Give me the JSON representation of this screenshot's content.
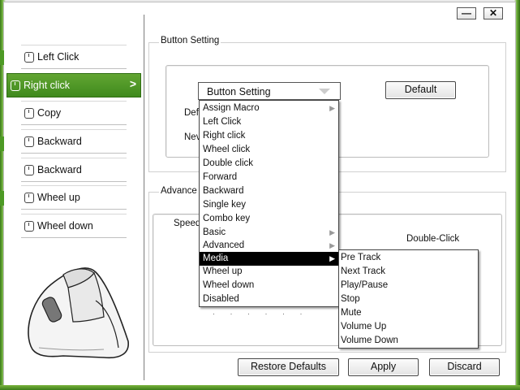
{
  "window": {
    "minimize_label": "—",
    "close_label": "✕"
  },
  "sidebar": {
    "items": [
      {
        "label": "Left Click"
      },
      {
        "label": "Right click"
      },
      {
        "label": "Copy"
      },
      {
        "label": "Backward"
      },
      {
        "label": "Backward"
      },
      {
        "label": "Wheel up"
      },
      {
        "label": "Wheel down"
      }
    ],
    "active_index": 1,
    "active_chevron": ">"
  },
  "button_setting": {
    "group_title": "Button Setting",
    "select_value": "Button Setting",
    "default_button": "Default",
    "field_label_1": "Def",
    "field_label_2": "Nev"
  },
  "advanced": {
    "group_title": "Advance",
    "speed_label": "Speed",
    "double_click_label": "Double-Click"
  },
  "dropdown": {
    "items": [
      {
        "label": "Assign Macro",
        "has_submenu": true
      },
      {
        "label": "Left Click",
        "has_submenu": false
      },
      {
        "label": "Right click",
        "has_submenu": false
      },
      {
        "label": "Wheel click",
        "has_submenu": false
      },
      {
        "label": "Double click",
        "has_submenu": false
      },
      {
        "label": "Forward",
        "has_submenu": false
      },
      {
        "label": "Backward",
        "has_submenu": false
      },
      {
        "label": "Single key",
        "has_submenu": false
      },
      {
        "label": "Combo key",
        "has_submenu": false
      },
      {
        "label": "Basic",
        "has_submenu": true
      },
      {
        "label": "Advanced",
        "has_submenu": true
      },
      {
        "label": "Media",
        "has_submenu": true
      },
      {
        "label": "Wheel up",
        "has_submenu": false
      },
      {
        "label": "Wheel down",
        "has_submenu": false
      },
      {
        "label": "Disabled",
        "has_submenu": false
      }
    ],
    "highlighted_index": 11,
    "submenu_arrow": "▶"
  },
  "media_submenu": {
    "items": [
      {
        "label": "Pre Track"
      },
      {
        "label": "Next Track"
      },
      {
        "label": "Play/Pause"
      },
      {
        "label": "Stop"
      },
      {
        "label": "Mute"
      },
      {
        "label": "Volume Up"
      },
      {
        "label": "Volume Down"
      }
    ]
  },
  "footer": {
    "restore_defaults": "Restore Defaults",
    "apply": "Apply",
    "discard": "Discard"
  },
  "colors": {
    "accent_green": "#4d9a25",
    "highlight": "#000000"
  }
}
